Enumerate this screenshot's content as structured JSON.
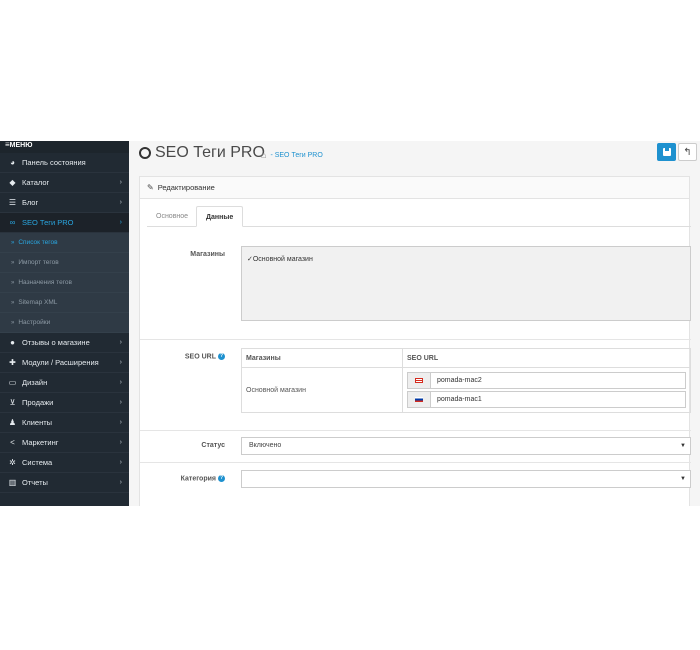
{
  "sidebar": {
    "menu_label": "МЕНЮ",
    "items": [
      {
        "label": "Панель состояния",
        "icon": "dashboard-icon"
      },
      {
        "label": "Каталог",
        "icon": "tag-icon"
      },
      {
        "label": "Блог",
        "icon": "list-icon"
      },
      {
        "label": "SEO Теги PRO",
        "icon": "link-icon"
      },
      {
        "label": "Отзывы о магазине",
        "icon": "comments-icon"
      },
      {
        "label": "Модули / Расширения",
        "icon": "puzzle-icon"
      },
      {
        "label": "Дизайн",
        "icon": "monitor-icon"
      },
      {
        "label": "Продажи",
        "icon": "cart-icon"
      },
      {
        "label": "Клиенты",
        "icon": "user-icon"
      },
      {
        "label": "Маркетинг",
        "icon": "share-icon"
      },
      {
        "label": "Система",
        "icon": "gear-icon"
      },
      {
        "label": "Отчеты",
        "icon": "bar-chart-icon"
      }
    ],
    "sub_items": [
      {
        "label": "Список тегов"
      },
      {
        "label": "Импорт тегов"
      },
      {
        "label": "Назначения тегов"
      },
      {
        "label": "Sitemap XML"
      },
      {
        "label": "Настройки"
      }
    ]
  },
  "header": {
    "title": "SEO Теги PRO",
    "breadcrumb": "SEO Теги PRO"
  },
  "panel": {
    "heading": "Редактирование",
    "tabs": [
      {
        "label": "Основное"
      },
      {
        "label": "Данные"
      }
    ]
  },
  "form": {
    "stores_label": "Магазины",
    "store_checked": "✓Основной магазин",
    "seo_url_label": "SEO URL",
    "seo_table": {
      "col_store": "Магазины",
      "col_url": "SEO URL",
      "store_name": "Основной магазин",
      "urls": [
        "pomada-mac2",
        "pomada-mac1"
      ]
    },
    "status_label": "Статус",
    "status_value": "Включено",
    "category_label": "Категория",
    "category_value": ""
  },
  "colors": {
    "accent": "#1e91cf",
    "sidebar_bg": "#212a33",
    "active_link": "#29a6e0"
  }
}
